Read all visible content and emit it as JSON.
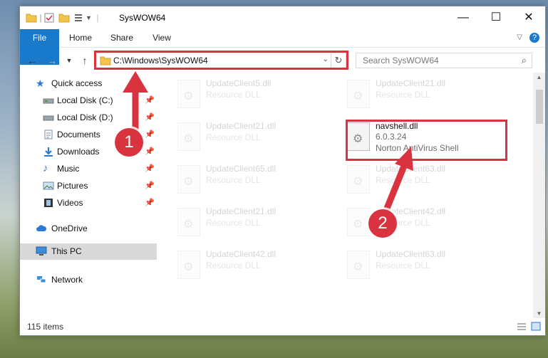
{
  "window": {
    "title": "SysWOW64",
    "controls": {
      "minimize": "—",
      "maximize": "☐",
      "close": "✕"
    }
  },
  "ribbon": {
    "tabs": [
      "File",
      "Home",
      "Share",
      "View"
    ],
    "help": "?"
  },
  "address": {
    "path": "C:\\Windows\\SysWOW64",
    "search_placeholder": "Search SysWOW64"
  },
  "sidebar": {
    "items": [
      {
        "label": "Quick access",
        "icon": "star-icon"
      },
      {
        "label": "Local Disk (C:)",
        "icon": "drive-icon",
        "pinned": true
      },
      {
        "label": "Local Disk (D:)",
        "icon": "drive-icon",
        "pinned": true
      },
      {
        "label": "Documents",
        "icon": "documents-icon",
        "pinned": true
      },
      {
        "label": "Downloads",
        "icon": "download-icon",
        "pinned": true
      },
      {
        "label": "Music",
        "icon": "music-icon",
        "pinned": true
      },
      {
        "label": "Pictures",
        "icon": "pictures-icon",
        "pinned": true
      },
      {
        "label": "Videos",
        "icon": "videos-icon",
        "pinned": true
      },
      {
        "label": "OneDrive",
        "icon": "cloud-icon"
      },
      {
        "label": "This PC",
        "icon": "computer-icon",
        "selected": true
      },
      {
        "label": "Network",
        "icon": "network-icon"
      }
    ]
  },
  "files": [
    {
      "name": "UpdateClient5.dll",
      "desc": "Resource DLL"
    },
    {
      "name": "UpdateClient21.dll",
      "desc": "Resource DLL"
    },
    {
      "name": "UpdateClient21.dll",
      "desc": "Resource DLL"
    },
    {
      "name": "navshell.dll",
      "version": "6.0.3.24",
      "desc": "Norton AntiVirus Shell",
      "highlighted": true
    },
    {
      "name": "UpdateClient65.dll",
      "desc": "Resource DLL"
    },
    {
      "name": "UpdateClient63.dll",
      "desc": "Resource DLL"
    },
    {
      "name": "UpdateClient21.dll",
      "desc": "Resource DLL"
    },
    {
      "name": "UpdateClient42.dll",
      "desc": "Resource DLL"
    },
    {
      "name": "UpdateClient42.dll",
      "desc": "Resource DLL"
    },
    {
      "name": "UpdateClient63.dll",
      "desc": "Resource DLL"
    }
  ],
  "status": {
    "item_count": "115 items"
  },
  "annotations": {
    "step1": "1",
    "step2": "2",
    "color": "#d9333f"
  }
}
